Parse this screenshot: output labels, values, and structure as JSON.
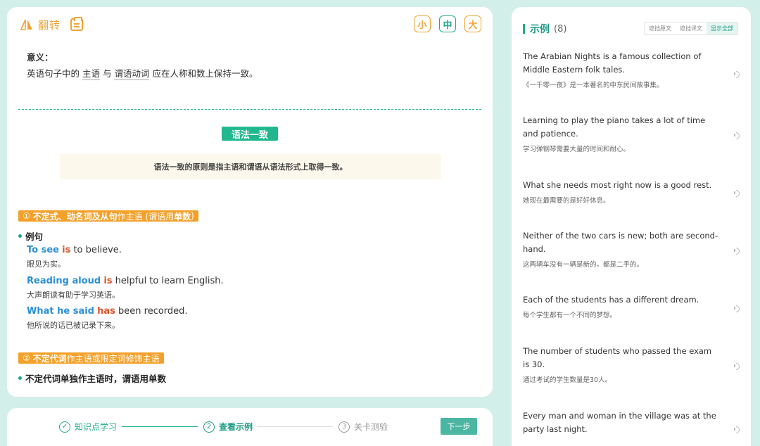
{
  "header": {
    "flip_label": "翻转"
  },
  "size_buttons": {
    "small": "小",
    "medium": "中",
    "large": "大"
  },
  "meaning": {
    "title": "意义：",
    "prefix": "英语句子中的 ",
    "term1": "主语",
    "mid": " 与 ",
    "term2": "谓语动词",
    "suffix": " 应在人称和数上保持一致。"
  },
  "grammar_tag": "语法一致",
  "note": "语法一致的原则是指主语和谓语从语法形式上取得一致。",
  "section1": {
    "num": "①",
    "bold1": "不定式、动名词及从句",
    "plain": "作主语 (谓语用",
    "bold2": "单数",
    "end": ")"
  },
  "bullet1": "例句",
  "examples": [
    {
      "subj": "To see",
      "verb": "is",
      "rest": " to believe.",
      "zh": "眼见为实。"
    },
    {
      "subj": "Reading aloud",
      "verb": "is",
      "rest": " helpful to learn English.",
      "zh": "大声朗读有助于学习英语。"
    },
    {
      "subj": "What he said",
      "verb": "has",
      "rest": " been recorded.",
      "zh": "他所说的话已被记录下来。"
    }
  ],
  "section2": {
    "num": "②",
    "bold1": "不定代词",
    "plain": "作主语或限定词修饰主语"
  },
  "bullet2": "不定代词单独作主语时，谓语用单数",
  "stepper": {
    "step1": {
      "icon": "✓",
      "label": "知识点学习"
    },
    "step2": {
      "icon": "2",
      "label": "查看示例"
    },
    "step3": {
      "icon": "3",
      "label": "关卡测验"
    },
    "next": "下一步"
  },
  "right": {
    "title": "示例",
    "count": "(8)",
    "tabs": [
      "遮挡原文",
      "遮挡译文",
      "显示全部"
    ],
    "items": [
      {
        "en": "The Arabian Nights is a famous collection of Middle Eastern folk tales.",
        "zh": "《一千零一夜》是一本著名的中东民间故事集。"
      },
      {
        "en": "Learning to play the piano takes a lot of time and patience.",
        "zh": "学习弹钢琴需要大量的时间和耐心。"
      },
      {
        "en": "What she needs most right now is a good rest.",
        "zh": "她现在最需要的是好好休息。"
      },
      {
        "en": "Neither of the two cars is new; both are second-hand.",
        "zh": "这两辆车没有一辆是新的，都是二手的。"
      },
      {
        "en": "Each of the students has a different dream.",
        "zh": "每个学生都有一个不同的梦想。"
      },
      {
        "en": "The number of students who passed the exam is 30.",
        "zh": "通过考试的学生数量是30人。"
      },
      {
        "en": "Every man and woman in the village was at the party last night.",
        "zh": ""
      }
    ]
  },
  "colors": {
    "accent_green": "#1fa98c",
    "accent_orange": "#f3a12b",
    "highlight_blue": "#2a8fd4",
    "highlight_red": "#e0542a"
  }
}
